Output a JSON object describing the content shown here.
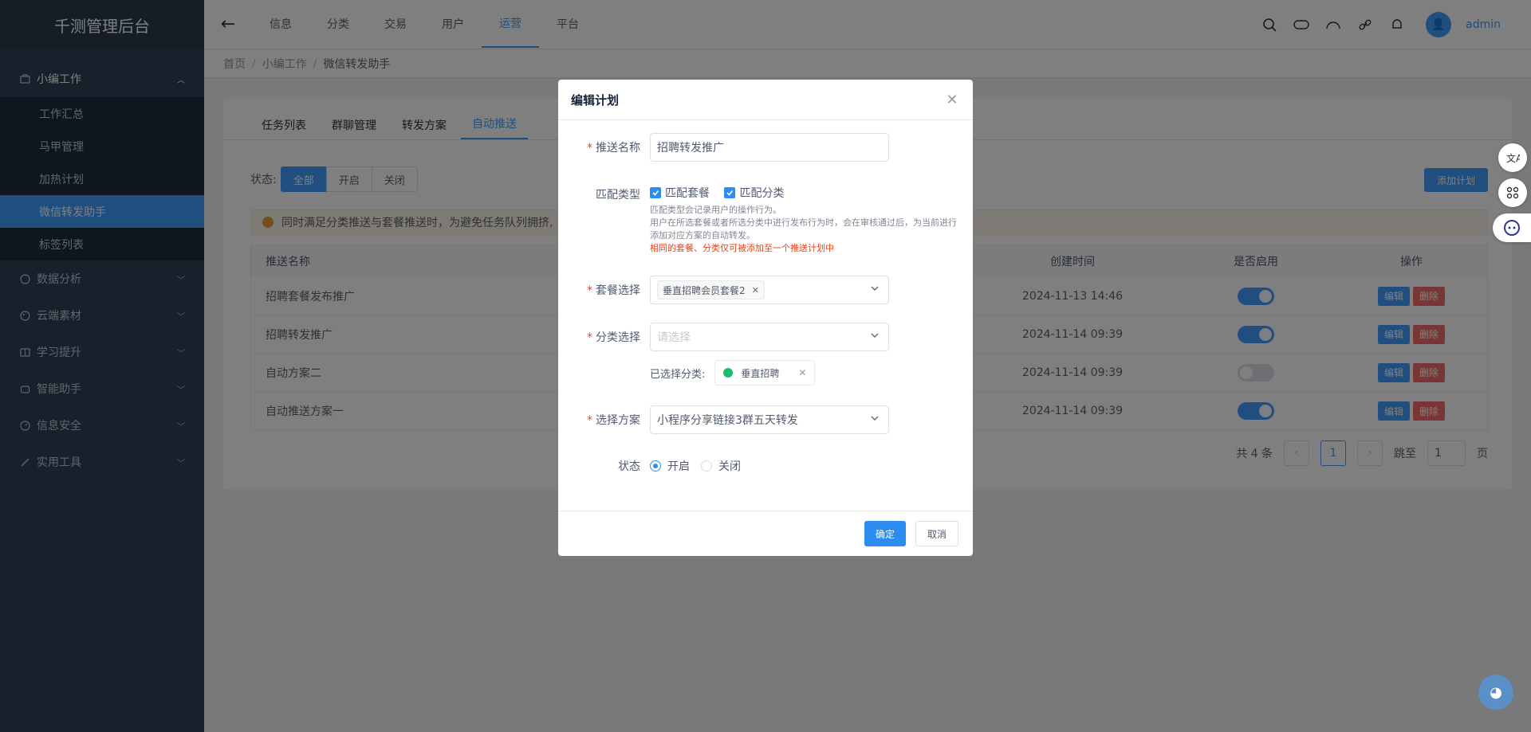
{
  "app": {
    "title": "千测管理后台"
  },
  "sidebar": {
    "groups": [
      {
        "label": "小编工作",
        "icon": "briefcase-icon",
        "open": true,
        "items": [
          {
            "label": "工作汇总",
            "active": false
          },
          {
            "label": "马甲管理",
            "active": false
          },
          {
            "label": "加热计划",
            "active": false
          },
          {
            "label": "微信转发助手",
            "active": true
          },
          {
            "label": "标签列表",
            "active": false
          }
        ]
      },
      {
        "label": "数据分析",
        "icon": "globe-icon"
      },
      {
        "label": "云端素材",
        "icon": "palette-icon"
      },
      {
        "label": "学习提升",
        "icon": "book-icon"
      },
      {
        "label": "智能助手",
        "icon": "robot-icon"
      },
      {
        "label": "信息安全",
        "icon": "gauge-icon"
      },
      {
        "label": "实用工具",
        "icon": "tool-icon"
      }
    ]
  },
  "header": {
    "tabs": [
      "信息",
      "分类",
      "交易",
      "用户",
      "运营",
      "平台"
    ],
    "active_tab": "运营",
    "username": "admin",
    "icons": [
      "search-icon",
      "gamepad-icon",
      "dashboard-icon",
      "link-icon",
      "bell-icon"
    ]
  },
  "breadcrumb": [
    "首页",
    "小编工作",
    "微信转发助手"
  ],
  "page": {
    "tabs": [
      "任务列表",
      "群聊管理",
      "转发方案",
      "自动推送"
    ],
    "active_tab": "自动推送",
    "filter_label": "状态:",
    "filter_options": [
      "全部",
      "开启",
      "关闭"
    ],
    "add_button": "添加计划",
    "alert_text": "同时满足分类推送与套餐推送时，为避免任务队列拥挤,",
    "table": {
      "headers": {
        "name": "推送名称",
        "created": "创建时间",
        "enabled": "是否启用",
        "ops": "操作"
      },
      "rows": [
        {
          "name": "招聘套餐发布推广",
          "created": "2024-11-13 14:46",
          "enabled": true
        },
        {
          "name": "招聘转发推广",
          "created": "2024-11-14 09:39",
          "enabled": true
        },
        {
          "name": "自动方案二",
          "created": "2024-11-14 09:39",
          "enabled": false
        },
        {
          "name": "自动推送方案一",
          "created": "2024-11-14 09:39",
          "enabled": true
        }
      ],
      "edit_label": "编辑",
      "delete_label": "删除"
    },
    "pager": {
      "total": "共 4 条",
      "current": "1",
      "jump_label": "跳至",
      "jump_value": "1",
      "page_unit": "页"
    }
  },
  "modal": {
    "title": "编辑计划",
    "name_label": "推送名称",
    "name_value": "招聘转发推广",
    "match_label": "匹配类型",
    "match_options": [
      "匹配套餐",
      "匹配分类"
    ],
    "match_help_1": "匹配类型会记录用户的操作行为。",
    "match_help_2": "用户在所选套餐或者所选分类中进行发布行为时，会在审核通过后，为当前进行添加对应方案的自动转发。",
    "match_help_red": "相同的套餐、分类仅可被添加至一个推送计划中",
    "package_label": "套餐选择",
    "package_tag": "垂直招聘会员套餐2",
    "category_label": "分类选择",
    "category_placeholder": "请选择",
    "selected_category_label": "已选择分类:",
    "selected_category": "垂直招聘",
    "scheme_label": "选择方案",
    "scheme_value": "小程序分享链接3群五天转发",
    "status_label": "状态",
    "status_on": "开启",
    "status_off": "关闭",
    "confirm": "确定",
    "cancel": "取消"
  },
  "colors": {
    "primary": "#409eff",
    "sidebar": "#304156",
    "danger": "#f56c6c",
    "required": "#ed4014"
  }
}
